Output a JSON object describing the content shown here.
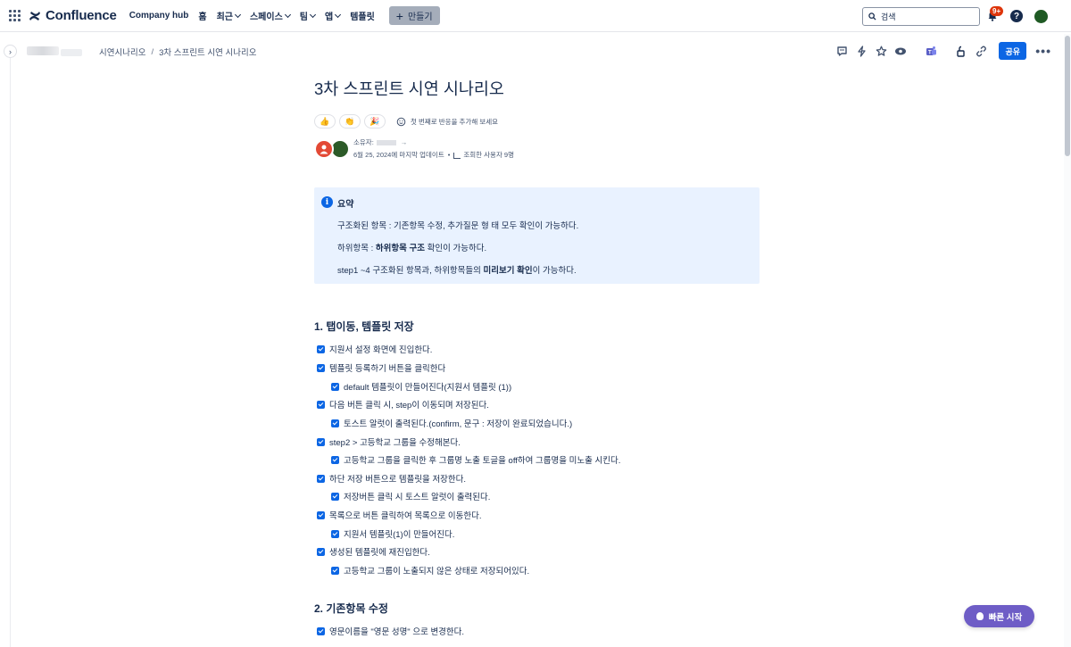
{
  "topnav": {
    "app_name": "Confluence",
    "items": [
      {
        "label": "Company hub",
        "has_dropdown": false
      },
      {
        "label": "홈",
        "has_dropdown": false
      },
      {
        "label": "최근",
        "has_dropdown": true
      },
      {
        "label": "스페이스",
        "has_dropdown": true
      },
      {
        "label": "팀",
        "has_dropdown": true
      },
      {
        "label": "앱",
        "has_dropdown": true
      },
      {
        "label": "템플릿",
        "has_dropdown": false
      }
    ],
    "create_label": "만들기",
    "search_placeholder": "검색",
    "notification_badge": "9+",
    "help_label": "?"
  },
  "breadcrumb": {
    "items": [
      "시연시나리오",
      "3차 스프린트 시연 시나리오"
    ],
    "separator": "/"
  },
  "toolbar": {
    "share_label": "공유",
    "more_label": "•••",
    "icons": [
      "comment-icon",
      "lightning-icon",
      "star-icon",
      "watch-icon",
      "teams-icon",
      "restrictions-icon",
      "link-icon"
    ]
  },
  "page": {
    "title": "3차 스프린트 시연 시나리오",
    "reactions": [
      "👍",
      "👏",
      "🎉"
    ],
    "reaction_hint": "첫 번째로 반응을 추가해 보세요",
    "owner_label": "소유자:",
    "updated": "6월 25, 2024에 마지막 업데이트",
    "viewers": "조회한 사용자 9명"
  },
  "summary_panel": {
    "title": "요약",
    "lines": [
      {
        "text": "구조화된 항목 : 기존항목 수정, 추가질문 형 태 모두 확인이 가능하다."
      },
      {
        "pre": "하위항목 : ",
        "bold": "하위항목 구조",
        "post": " 확인이 가능하다."
      },
      {
        "pre": "step1 ~4 구조화된 항목과, 하위항목들의 ",
        "bold": "미리보기 확인",
        "post": "이 가능하다."
      }
    ]
  },
  "sections": [
    {
      "heading": "1. 탭이동, 템플릿 저장",
      "tasks": [
        {
          "text": "지원서 설정 화면에 진입한다.",
          "level": 0
        },
        {
          "text": "템플릿 등록하기 버튼을 클릭한다",
          "level": 0
        },
        {
          "text": "default 템플릿이 만들어진다(지원서 템플릿 (1))",
          "level": 1
        },
        {
          "text": "다음 버튼 클릭 시, step이 이동되며 저장된다.",
          "level": 0
        },
        {
          "text": "토스트 알럿이 출력된다.(confirm, 문구 : 저장이 완료되었습니다.)",
          "level": 1
        },
        {
          "text": "step2 > 고등학교 그룹을 수정해본다.",
          "level": 0
        },
        {
          "text": "고등학교 그룹을 클릭한 후 그룹명 노출 토글을 off하여 그룹명을 미노출 시킨다.",
          "level": 1
        },
        {
          "text": "하단 저장 버튼으로 템플릿을 저장한다.",
          "level": 0
        },
        {
          "text": "저장버튼 클릭 시 토스트 알럿이 출력된다.",
          "level": 1
        },
        {
          "text": "목록으로 버튼 클릭하여 목록으로 이동한다.",
          "level": 0
        },
        {
          "text": "지원서 템플릿(1)이 만들어진다.",
          "level": 1
        },
        {
          "text": "생성된 템플릿에 재진입한다.",
          "level": 0
        },
        {
          "text": "고등학교 그룹이 노출되지 않은 상태로 저장되어있다.",
          "level": 1
        }
      ]
    },
    {
      "heading": "2. 기존항목 수정",
      "tasks": [
        {
          "text": "영문이름을 \"영문 성명\" 으로 변경한다.",
          "level": 0
        }
      ]
    }
  ],
  "quick_start": {
    "label": "빠른 시작"
  },
  "colors": {
    "accent": "#0c66e4",
    "panel_bg": "#e9f2ff",
    "quick_start": "#6e5dc6",
    "badge": "#de350b"
  }
}
